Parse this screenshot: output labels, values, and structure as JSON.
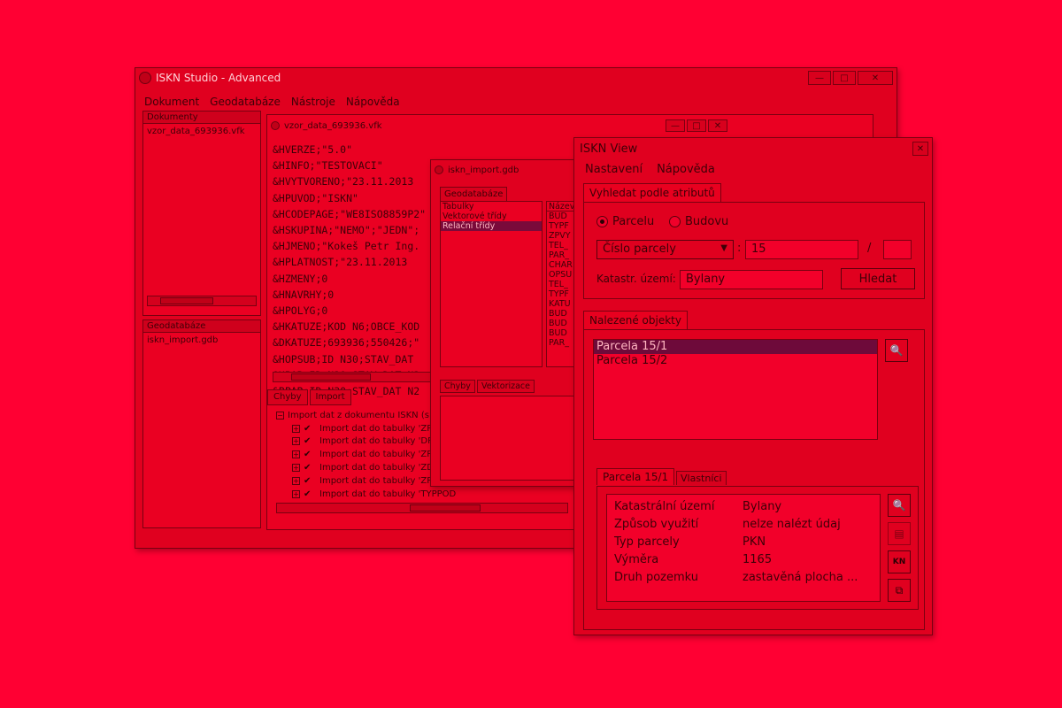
{
  "main_window": {
    "title": "ISKN Studio - Advanced",
    "menu": [
      "Dokument",
      "Geodatabáze",
      "Nástroje",
      "Nápověda"
    ],
    "documents_panel": {
      "header": "Dokumenty",
      "items": [
        "vzor_data_693936.vfk"
      ]
    },
    "geodb_panel": {
      "header": "Geodatabáze",
      "items": [
        "iskn_import.gdb"
      ]
    }
  },
  "doc_window": {
    "title": "vzor_data_693936.vfk",
    "lines": [
      "&HVERZE;\"5.0\"",
      "&HINFO;\"TESTOVACI\"",
      "&HVYTVORENO;\"23.11.2013",
      "&HPUVOD;\"ISKN\"",
      "&HCODEPAGE;\"WE8ISO8859P2\"",
      "&HSKUPINA;\"NEMO\";\"JEDN\";",
      "&HJMENO;\"Kokeš Petr Ing.",
      "&HPLATNOST;\"23.11.2013 ",
      "&HZMENY;0",
      "&HNAVRHY;0",
      "&HPOLYG;0",
      "&HKATUZE;KOD N6;OBCE_KOD",
      "&DKATUZE;693936;550426;\"",
      "&HOPSUB;ID N30;STAV_DAT ",
      "&HPAR;ID N30;STAV_DAT N2",
      "&BPAR;ID N30;STAV_DAT N2"
    ],
    "bottom_tabs": [
      "Chyby",
      "Import"
    ],
    "tree_root": "Import dat z dokumentu ISKN (s",
    "tree_items": [
      "Import dat do tabulky 'ZPOC",
      "Import dat do tabulky 'DRUI",
      "Import dat do tabulky 'ZPVI",
      "Import dat do tabulky 'ZDPA",
      "Import dat do tabulky 'ZPUR",
      "Import dat do tabulky 'TYPPOD"
    ]
  },
  "import_window": {
    "title": "iskn_import.gdb",
    "tab": "Geodatabáze",
    "list": [
      "Tabulky",
      "Vektorové třídy",
      "Relační třídy"
    ],
    "selected_index": 2,
    "right_header": "Název",
    "right_items": [
      "BUD",
      "TYPF",
      "ZPVY",
      "TEL_",
      "PAR_",
      "CHAR",
      "OPSU",
      "TEL_",
      "TYPF",
      "KATU",
      "BUD",
      "BUD",
      "BUD",
      "PAR_"
    ],
    "bottom_tabs": [
      "Chyby",
      "Vektorizace"
    ]
  },
  "view_window": {
    "title": "ISKN View",
    "menu": [
      "Nastavení",
      "Nápověda"
    ],
    "search_tab": "Vyhledat podle atributů",
    "radio_parcelu": "Parcelu",
    "radio_budovu": "Budovu",
    "parcel_select": "Číslo parcely",
    "colon": ":",
    "parcel_number": "15",
    "slash": "/",
    "parcel_sub": "",
    "katastr_label": "Katastr. území:",
    "katastr_value": "Bylany",
    "search_button": "Hledat",
    "found_tab": "Nalezené objekty",
    "found_items": [
      "Parcela 15/1",
      "Parcela 15/2"
    ],
    "detail_tabs": [
      "Parcela 15/1",
      "Vlastníci"
    ],
    "properties": [
      {
        "k": "Katastrální území",
        "v": "Bylany"
      },
      {
        "k": "Způsob využití",
        "v": "nelze nalézt údaj"
      },
      {
        "k": "Typ parcely",
        "v": "PKN"
      },
      {
        "k": "Výměra",
        "v": "1165"
      },
      {
        "k": "Druh pozemku",
        "v": "zastavěná plocha ..."
      }
    ],
    "kn_icon_text": "KN",
    "close_glyph": "✕"
  },
  "win_glyphs": {
    "minimize": "—",
    "maximize": "□",
    "close": "✕"
  }
}
